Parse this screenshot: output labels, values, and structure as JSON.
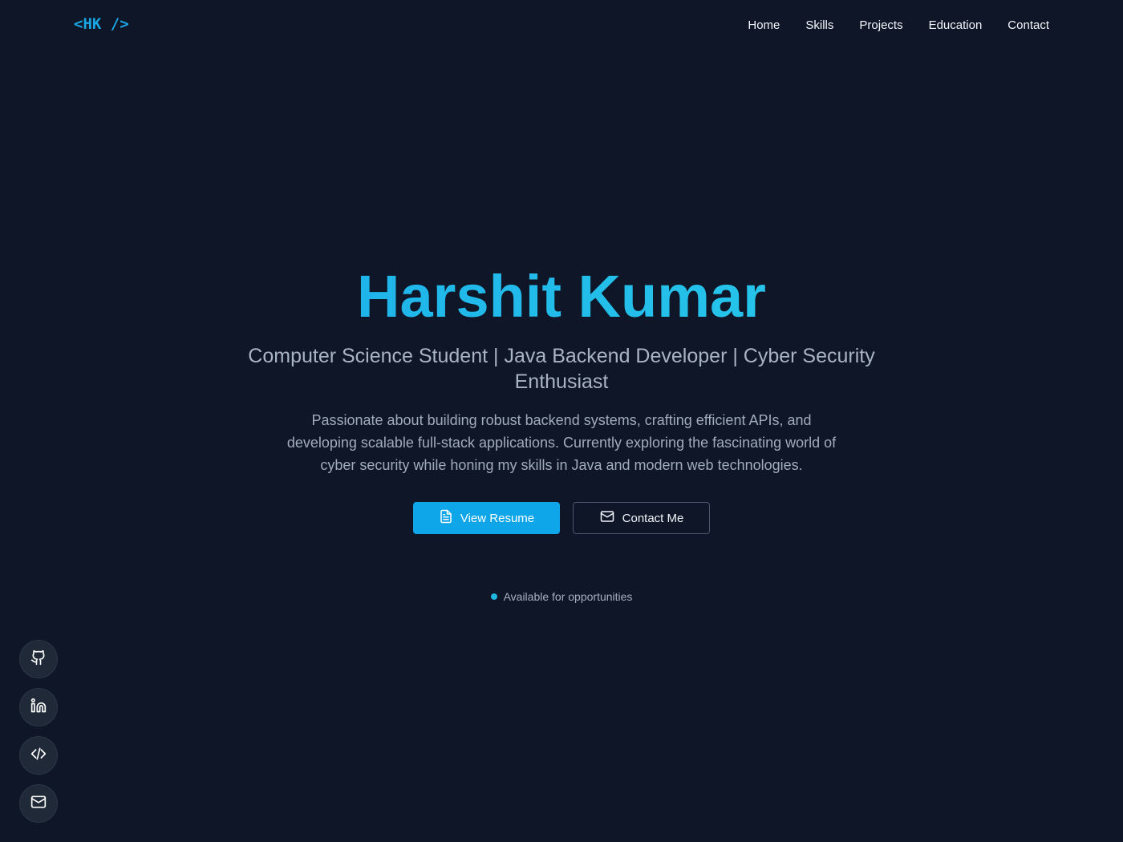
{
  "header": {
    "logo": "<HK />",
    "nav": [
      {
        "label": "Home"
      },
      {
        "label": "Skills"
      },
      {
        "label": "Projects"
      },
      {
        "label": "Education"
      },
      {
        "label": "Contact"
      }
    ]
  },
  "hero": {
    "name": "Harshit Kumar",
    "roles": "Computer Science Student | Java Backend Developer | Cyber Security Enthusiast",
    "description": "Passionate about building robust backend systems, crafting efficient APIs, and developing scalable full-stack applications. Currently exploring the fascinating world of cyber security while honing my skills in Java and modern web technologies.",
    "buttons": {
      "primary": {
        "label": "View Resume",
        "icon": "file-icon"
      },
      "secondary": {
        "label": "Contact Me",
        "icon": "mail-icon"
      }
    },
    "status": "Available for opportunities"
  },
  "social": [
    {
      "icon": "github-icon"
    },
    {
      "icon": "linkedin-icon"
    },
    {
      "icon": "code-icon"
    },
    {
      "icon": "mail-icon"
    }
  ],
  "colors": {
    "background": "#0e1627",
    "accent": "#0ea5e9",
    "name_gradient_start": "#1aa8ea",
    "name_gradient_end": "#2bd0ea",
    "status_dot": "#1fb6dc"
  }
}
